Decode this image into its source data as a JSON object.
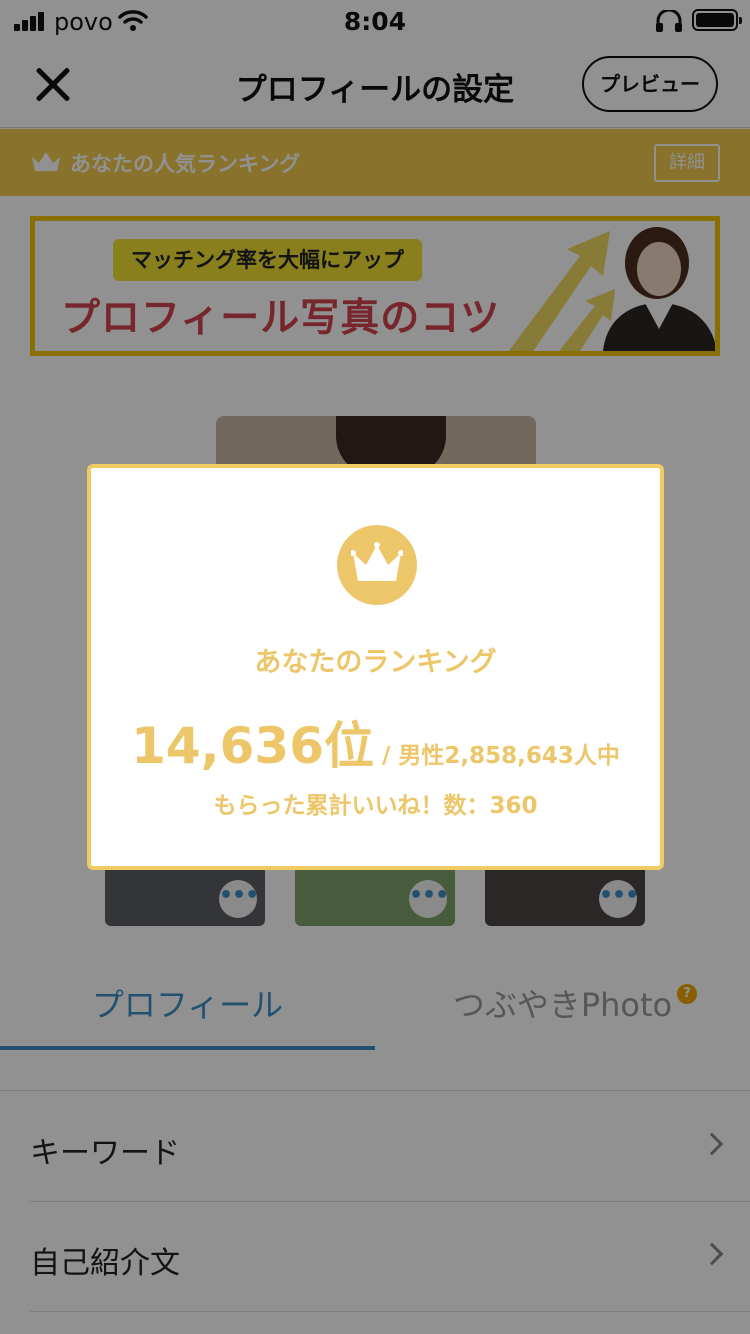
{
  "status_bar": {
    "carrier": "povo",
    "time": "8:04"
  },
  "nav": {
    "title": "プロフィールの設定",
    "preview_label": "プレビュー"
  },
  "ranking_strip": {
    "label": "あなたの人気ランキング",
    "detail_label": "詳細"
  },
  "banner": {
    "tag": "マッチング率を大幅にアップ",
    "headline": "プロフィール写真のコツ"
  },
  "tabs": [
    {
      "label": "プロフィール",
      "active": true
    },
    {
      "label": "つぶやきPhoto",
      "active": false,
      "badge": "?"
    }
  ],
  "list": [
    {
      "label": "キーワード"
    },
    {
      "label": "自己紹介文"
    }
  ],
  "modal": {
    "title": "あなたのランキング",
    "rank": "14,636位",
    "rank_sub": " / 男性2,858,643人中",
    "likes": "もらった累計いいね！数：360"
  },
  "colors": {
    "accent_gold": "#ecc669",
    "tab_blue": "#3b8fc4",
    "banner_red": "#d2434f"
  },
  "icons": {
    "close": "close-icon",
    "crown": "crown-icon",
    "more": "more-dots-icon",
    "chevron": "chevron-right-icon"
  }
}
